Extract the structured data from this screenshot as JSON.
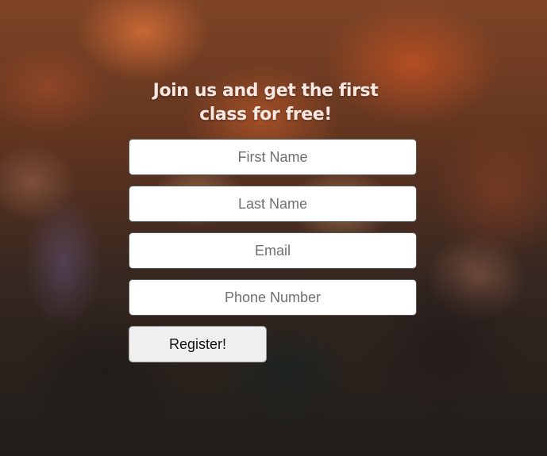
{
  "form": {
    "heading": "Join us and get the first class for free!",
    "fields": [
      {
        "placeholder": "First Name",
        "value": ""
      },
      {
        "placeholder": "Last Name",
        "value": ""
      },
      {
        "placeholder": "Email",
        "value": ""
      },
      {
        "placeholder": "Phone Number",
        "value": ""
      }
    ],
    "submit_label": "Register!"
  }
}
